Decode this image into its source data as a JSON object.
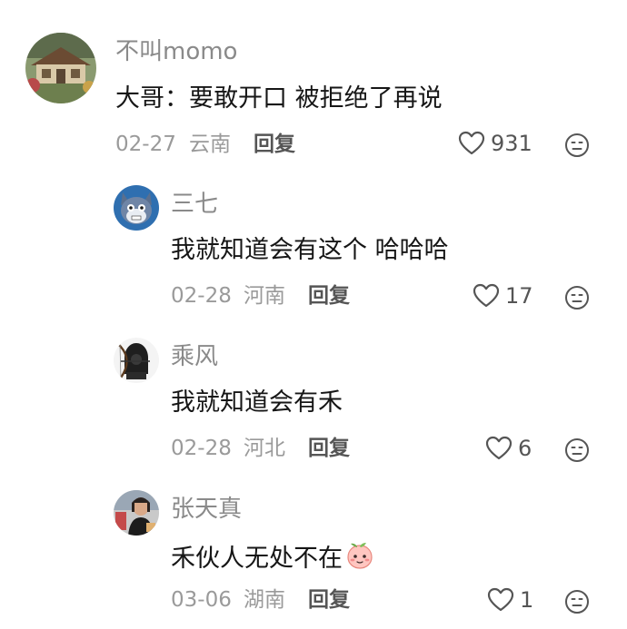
{
  "comments": [
    {
      "username": "不叫momo",
      "text": "大哥：要敢开口 被拒绝了再说",
      "date": "02-27",
      "location": "云南",
      "reply_label": "回复",
      "likes": "931",
      "avatar": "house-photo-avatar"
    },
    {
      "username": "三七",
      "text": "我就知道会有这个 哈哈哈",
      "date": "02-28",
      "location": "河南",
      "reply_label": "回复",
      "likes": "17",
      "avatar": "tom-cat-avatar"
    },
    {
      "username": "乘风",
      "text": "我就知道会有禾",
      "date": "02-28",
      "location": "河北",
      "reply_label": "回复",
      "likes": "6",
      "avatar": "hooded-archer-avatar"
    },
    {
      "username": "张天真",
      "text": "禾伙人无处不在",
      "date": "03-06",
      "location": "湖南",
      "reply_label": "回复",
      "likes": "1",
      "avatar": "person-photo-avatar",
      "text_emoji": "peach-face-emoji"
    }
  ],
  "icons": {
    "like": "heart-outline-icon",
    "dislike": "neutral-face-icon"
  },
  "colors": {
    "username": "#8a8a8a",
    "text": "#161616",
    "meta": "#9a9a9a",
    "reply": "#555555",
    "icon": "#555555"
  }
}
